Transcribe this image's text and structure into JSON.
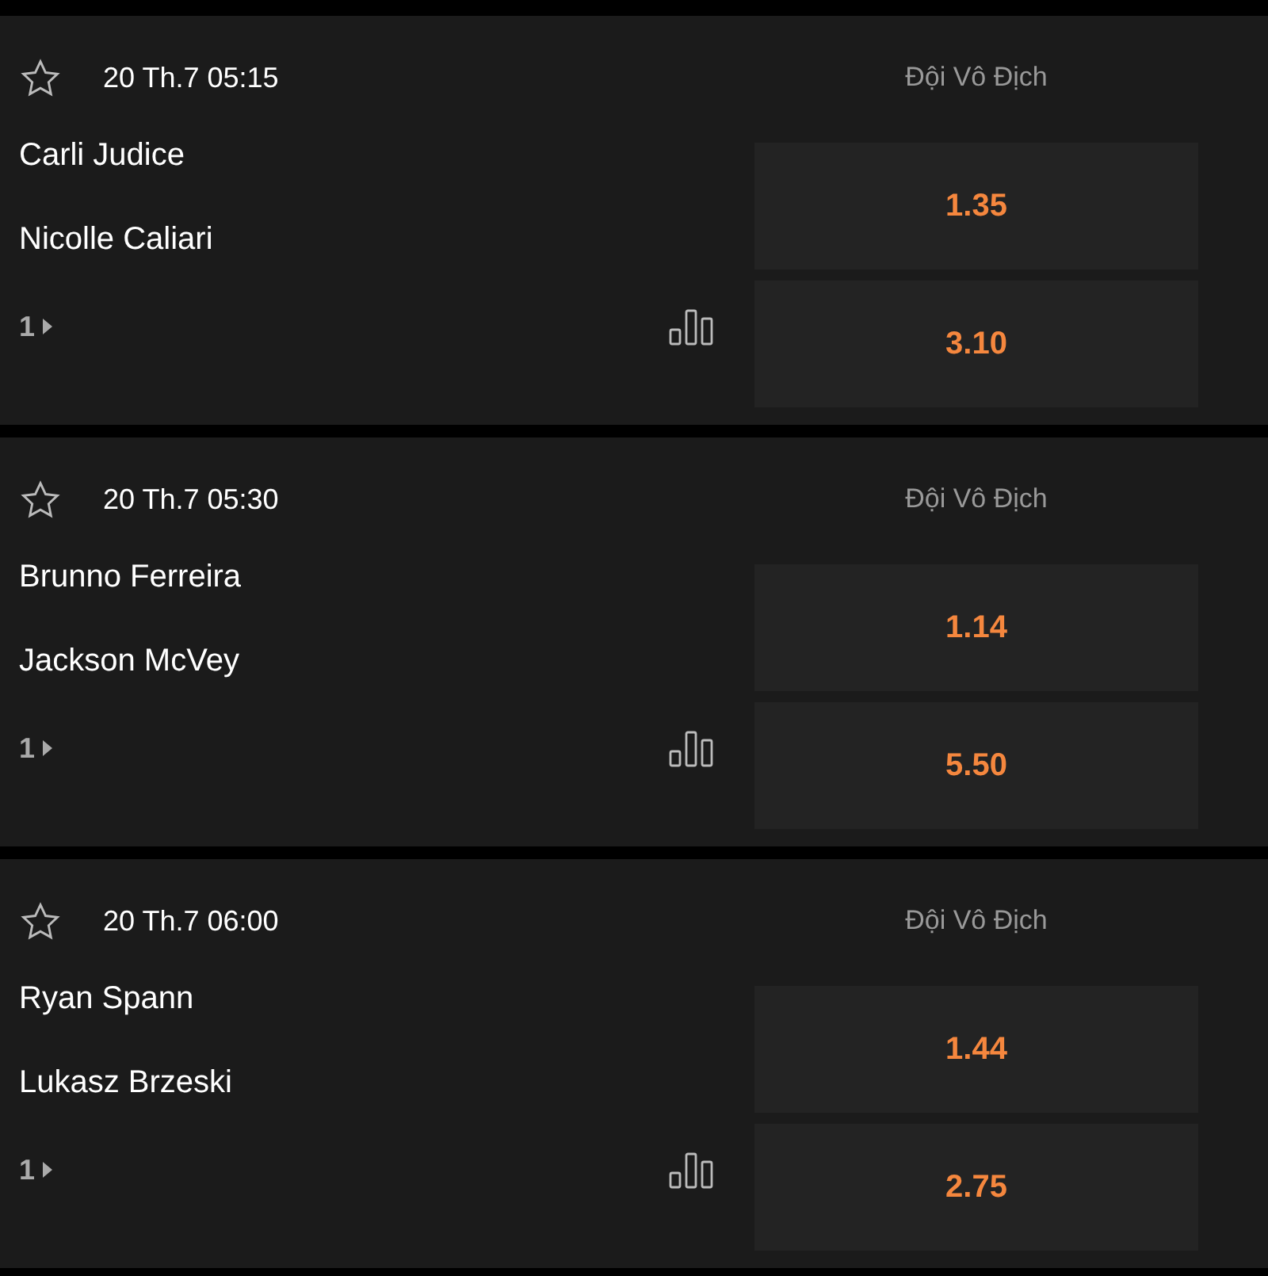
{
  "matches": [
    {
      "time": "20 Th.7 05:15",
      "market": "Đội Vô Địch",
      "players": [
        "Carli Judice",
        "Nicolle Caliari"
      ],
      "odds": [
        "1.35",
        "3.10"
      ],
      "more": "1",
      "favorite": false
    },
    {
      "time": "20 Th.7 05:30",
      "market": "Đội Vô Địch",
      "players": [
        "Brunno Ferreira",
        "Jackson McVey"
      ],
      "odds": [
        "1.14",
        "5.50"
      ],
      "more": "1",
      "favorite": false
    },
    {
      "time": "20 Th.7 06:00",
      "market": "Đội Vô Địch",
      "players": [
        "Ryan Spann",
        "Lukasz Brzeski"
      ],
      "odds": [
        "1.44",
        "2.75"
      ],
      "more": "1",
      "favorite": false
    }
  ]
}
